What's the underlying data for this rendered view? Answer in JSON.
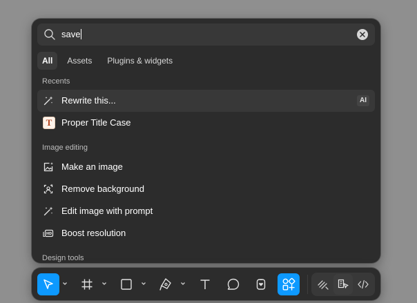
{
  "search": {
    "query": "save",
    "placeholder": ""
  },
  "tabs": [
    {
      "label": "All",
      "active": true
    },
    {
      "label": "Assets",
      "active": false
    },
    {
      "label": "Plugins & widgets",
      "active": false
    }
  ],
  "sections": {
    "recents": "Recents",
    "image_editing": "Image editing",
    "design_tools": "Design tools"
  },
  "recents": [
    {
      "label": "Rewrite this...",
      "icon": "magic-wand-icon",
      "badge": "AI"
    },
    {
      "label": "Proper Title Case",
      "icon": "plugin-t-icon",
      "glyph": "T"
    }
  ],
  "image_editing": [
    {
      "label": "Make an image",
      "icon": "image-sparkle-icon"
    },
    {
      "label": "Remove background",
      "icon": "remove-background-icon"
    },
    {
      "label": "Edit image with prompt",
      "icon": "magic-wand-icon"
    },
    {
      "label": "Boost resolution",
      "icon": "hd-icon"
    }
  ],
  "toolbar": {
    "tools": [
      "move-tool",
      "frame-tool",
      "shape-tool",
      "pen-tool",
      "text-tool",
      "comment-tool",
      "actions-tool",
      "assets-tool"
    ],
    "active_tool": "assets-tool",
    "modes": [
      "draw-mode",
      "design-mode",
      "dev-mode"
    ],
    "active_mode": "design-mode"
  },
  "colors": {
    "accent": "#0d99ff",
    "panel": "#2c2c2c",
    "row_hover": "#383838"
  }
}
